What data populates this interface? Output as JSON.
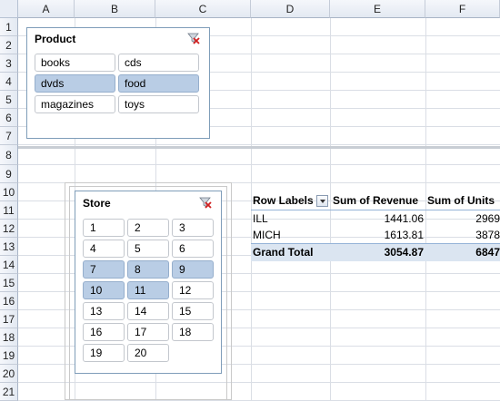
{
  "columns": [
    "A",
    "B",
    "C",
    "D",
    "E",
    "F"
  ],
  "rows": [
    "1",
    "2",
    "3",
    "4",
    "5",
    "6",
    "7",
    "8",
    "9",
    "10",
    "11",
    "12",
    "13",
    "14",
    "15",
    "16",
    "17",
    "18",
    "19",
    "20",
    "21"
  ],
  "product_slicer": {
    "title": "Product",
    "clear_icon": "clear-filter-icon",
    "items": [
      {
        "label": "books",
        "selected": false
      },
      {
        "label": "cds",
        "selected": false
      },
      {
        "label": "dvds",
        "selected": true
      },
      {
        "label": "food",
        "selected": true
      },
      {
        "label": "magazines",
        "selected": false
      },
      {
        "label": "toys",
        "selected": false
      }
    ]
  },
  "store_slicer": {
    "title": "Store",
    "clear_icon": "clear-filter-icon",
    "items": [
      {
        "label": "1",
        "selected": false
      },
      {
        "label": "2",
        "selected": false
      },
      {
        "label": "3",
        "selected": false
      },
      {
        "label": "4",
        "selected": false
      },
      {
        "label": "5",
        "selected": false
      },
      {
        "label": "6",
        "selected": false
      },
      {
        "label": "7",
        "selected": true
      },
      {
        "label": "8",
        "selected": true
      },
      {
        "label": "9",
        "selected": true
      },
      {
        "label": "10",
        "selected": true
      },
      {
        "label": "11",
        "selected": true
      },
      {
        "label": "12",
        "selected": false
      },
      {
        "label": "13",
        "selected": false
      },
      {
        "label": "14",
        "selected": false
      },
      {
        "label": "15",
        "selected": false
      },
      {
        "label": "16",
        "selected": false
      },
      {
        "label": "17",
        "selected": false
      },
      {
        "label": "18",
        "selected": false
      },
      {
        "label": "19",
        "selected": false
      },
      {
        "label": "20",
        "selected": false
      }
    ]
  },
  "pivot": {
    "headers": [
      "Row Labels",
      "Sum of Revenue",
      "Sum of Units"
    ],
    "rows": [
      {
        "label": "ILL",
        "revenue": "1441.06",
        "units": "2969"
      },
      {
        "label": "MICH",
        "revenue": "1613.81",
        "units": "3878"
      }
    ],
    "total": {
      "label": "Grand Total",
      "revenue": "3054.87",
      "units": "6847"
    }
  },
  "colors": {
    "selected_item": "#b9cde5",
    "slicer_border": "#7f9db9",
    "total_row": "#dbe5f1"
  }
}
